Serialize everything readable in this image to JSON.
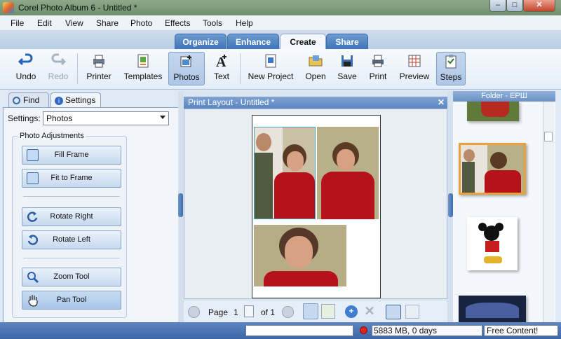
{
  "window": {
    "title": "Corel Photo Album 6 - Untitled *",
    "min_label": "–",
    "max_label": "□",
    "close_label": "✕"
  },
  "menu": [
    "File",
    "Edit",
    "View",
    "Share",
    "Photo",
    "Effects",
    "Tools",
    "Help"
  ],
  "main_tabs": [
    "Organize",
    "Enhance",
    "Create",
    "Share"
  ],
  "toolbar": {
    "undo": "Undo",
    "redo": "Redo",
    "printer": "Printer",
    "templates": "Templates",
    "photos": "Photos",
    "text": "Text",
    "new_project": "New Project",
    "open": "Open",
    "save": "Save",
    "print": "Print",
    "preview": "Preview",
    "steps": "Steps"
  },
  "left_panel": {
    "tab_find": "Find",
    "tab_settings": "Settings",
    "settings_label": "Settings:",
    "settings_value": "Photos",
    "group_label": "Photo Adjustments",
    "fill_frame": "Fill Frame",
    "fit_to_frame": "Fit to Frame",
    "rotate_right": "Rotate Right",
    "rotate_left": "Rotate Left",
    "zoom_tool": "Zoom Tool",
    "pan_tool": "Pan Tool"
  },
  "print_layout": {
    "title": "Print Layout - Untitled *",
    "close": "✕",
    "page_label": "Page",
    "page_value": "1",
    "of_label": "of 1"
  },
  "folder": {
    "title": "Folder - ЕРШ"
  },
  "status": {
    "disk": "5883 MB, 0 days",
    "free_content": "Free Content!"
  },
  "colors": {
    "accent": "#3f74b8",
    "tab_active_bg": "#f4f8fd",
    "status_bar": "#4a72b2",
    "selected_thumb_border": "#e8a23b"
  }
}
